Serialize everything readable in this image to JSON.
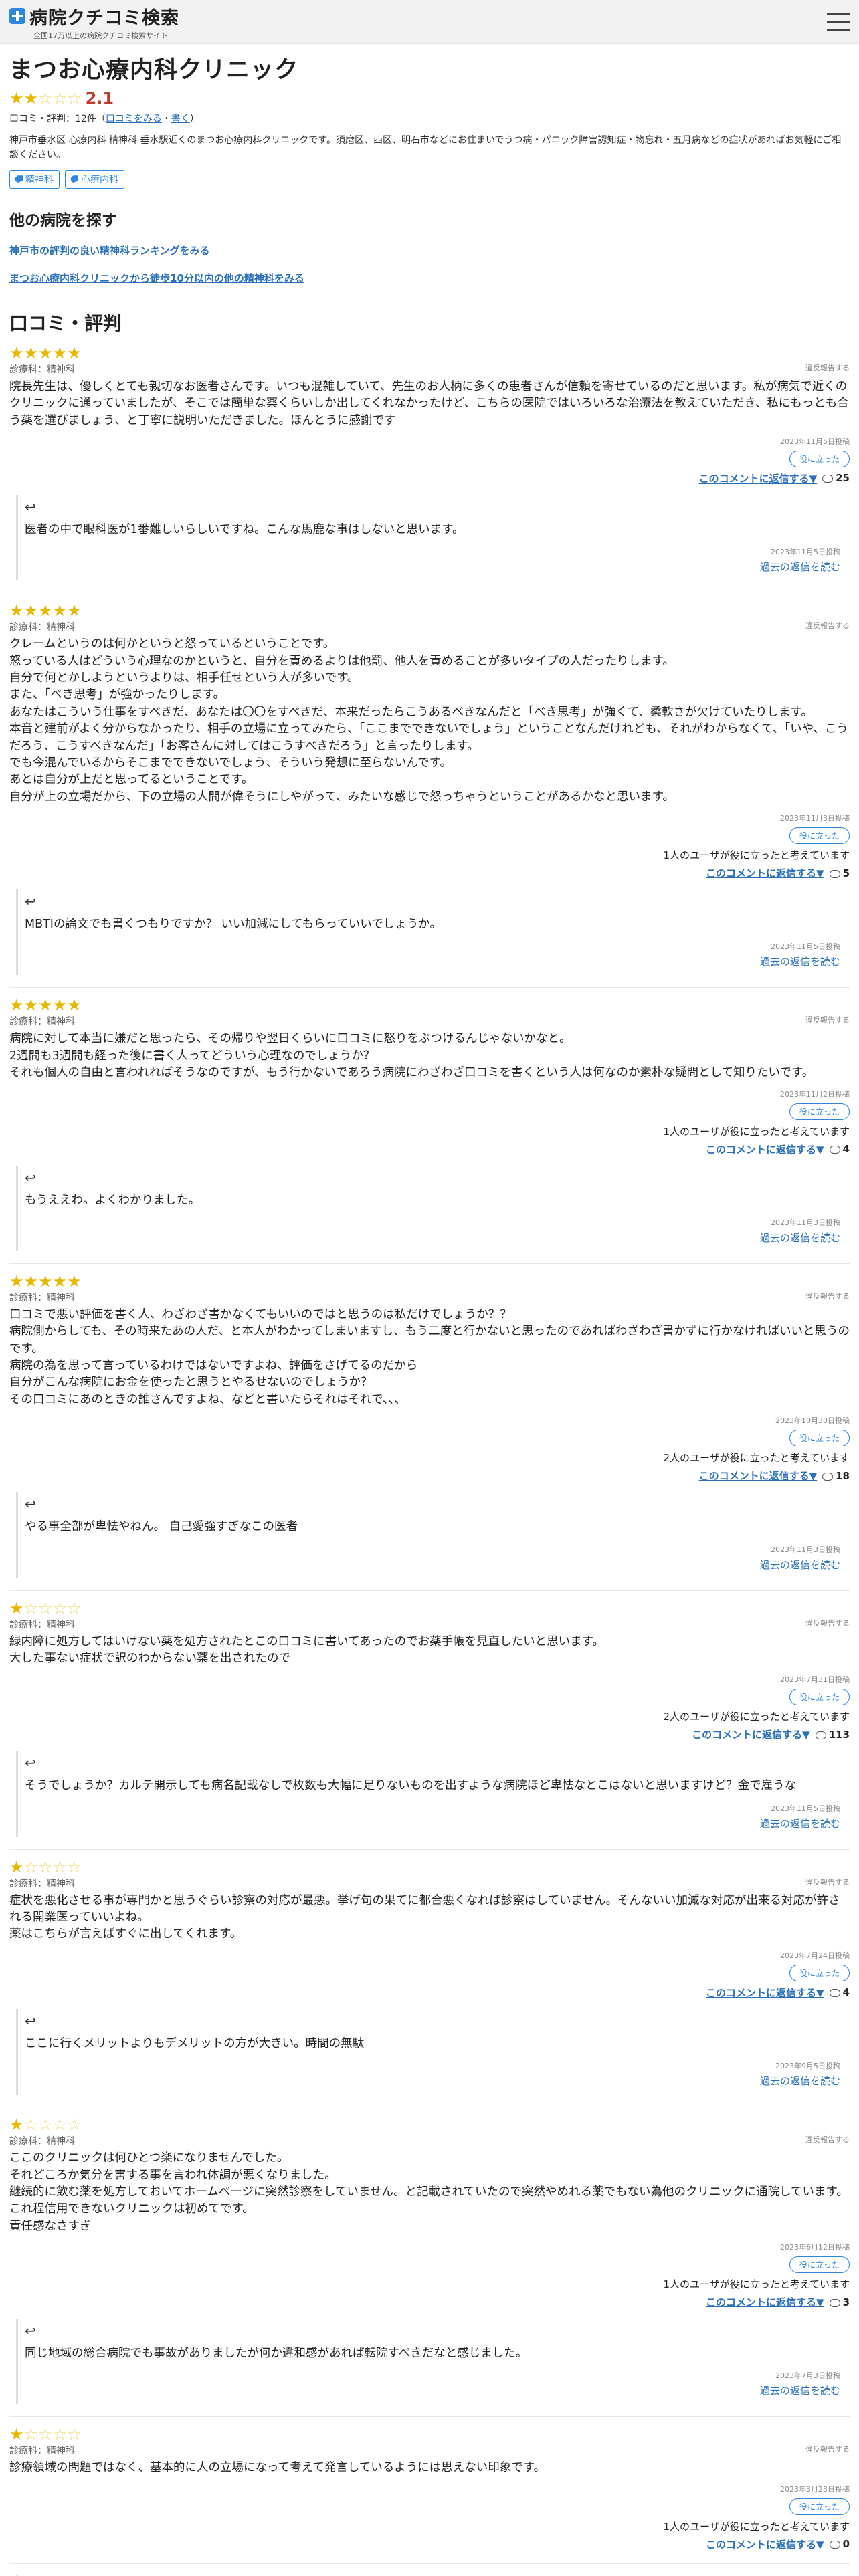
{
  "header": {
    "site_name": "病院クチコミ検索",
    "site_sub": "全国17万以上の病院クチコミ検索サイト"
  },
  "clinic": {
    "name": "まつお心療内科クリニック",
    "rating": "2.1",
    "rating_stars_filled": 2,
    "count_label": "口コミ・評判：12件（",
    "see_reviews": "口コミをみる",
    "sep": "・",
    "write": "書く",
    "count_close": "）",
    "description": "神戸市垂水区 心療内科 精神科 垂水駅近くのまつお心療内科クリニックです。須磨区、西区、明石市などにお住まいでうつ病・パニック障害認知症・物忘れ・五月病などの症状があればお気軽にご相談ください。",
    "tags": [
      "精神科",
      "心療内科"
    ]
  },
  "other": {
    "title": "他の病院を探す",
    "links": [
      "神戸市の評判の良い精神科ランキングをみる",
      "まつお心療内科クリニックから徒歩10分以内の他の精神科をみる"
    ]
  },
  "reviews_title": "口コミ・評判",
  "labels": {
    "report": "違反報告する",
    "helpful": "役に立った",
    "reply_to_comment": "このコメントに返信する▼",
    "past_replies": "過去の返信を読む"
  },
  "reviews": [
    {
      "stars": 5,
      "dept": "診療科：精神科",
      "text": "院長先生は、優しくとても親切なお医者さんです。いつも混雑していて、先生のお人柄に多くの患者さんが信頼を寄せているのだと思います。私が病気で近くのクリニックに通っていましたが、そこでは簡単な薬くらいしか出してくれなかったけど、こちらの医院ではいろいろな治療法を教えていただき、私にもっとも合う薬を選びましょう、と丁寧に説明いただきました。ほんとうに感謝です",
      "date": "2023年11月5日投稿",
      "helpful": "",
      "replies": "25",
      "reply": {
        "text": "医者の中で眼科医が1番難しいらしいですね。こんな馬鹿な事はしないと思います。",
        "date": "2023年11月5日投稿"
      }
    },
    {
      "stars": 5,
      "dept": "診療科：精神科",
      "text": "クレームというのは何かというと怒っているということです。\n怒っている人はどういう心理なのかというと、自分を責めるよりは他罰、他人を責めることが多いタイプの人だったりします。\n自分で何とかしようというよりは、相手任せという人が多いです。\nまた、「べき思考」が強かったりします。\nあなたはこういう仕事をすべきだ、あなたは〇〇をすべきだ、本来だったらこうあるべきなんだと「べき思考」が強くて、柔軟さが欠けていたりします。\n本音と建前がよく分からなかったり、相手の立場に立ってみたら、「ここまでできないでしょう」ということなんだけれども、それがわからなくて、「いや、こうだろう、こうすべきなんだ」「お客さんに対してはこうすべきだろう」と言ったりします。\nでも今混んでいるからそこまでできないでしょう、そういう発想に至らないんです。\nあとは自分が上だと思ってるということです。\n自分が上の立場だから、下の立場の人間が偉そうにしやがって、みたいな感じで怒っちゃうということがあるかなと思います。",
      "date": "2023年11月3日投稿",
      "helpful": "1人のユーザが役に立ったと考えています",
      "replies": "5",
      "reply": {
        "text": "MBTIの論文でも書くつもりですか？ いい加減にしてもらっていいでしょうか。",
        "date": "2023年11月5日投稿"
      }
    },
    {
      "stars": 5,
      "dept": "診療科：精神科",
      "text": "病院に対して本当に嫌だと思ったら、その帰りや翌日くらいに口コミに怒りをぶつけるんじゃないかなと。\n2週間も3週間も経った後に書く人ってどういう心理なのでしょうか？\nそれも個人の自由と言われればそうなのですが、もう行かないであろう病院にわざわざ口コミを書くという人は何なのか素朴な疑問として知りたいです。",
      "date": "2023年11月2日投稿",
      "helpful": "1人のユーザが役に立ったと考えています",
      "replies": "4",
      "reply": {
        "text": "もうええわ。よくわかりました。",
        "date": "2023年11月3日投稿"
      }
    },
    {
      "stars": 5,
      "dept": "診療科：精神科",
      "text": "口コミで悪い評価を書く人、わざわざ書かなくてもいいのではと思うのは私だけでしょうか？？\n病院側からしても、その時来たあの人だ、と本人がわかってしまいますし、もう二度と行かないと思ったのであればわざわざ書かずに行かなければいいと思うのです。\n病院の為を思って言っているわけではないですよね、評価をさげてるのだから\n自分がこんな病院にお金を使ったと思うとやるせないのでしょうか？\nその口コミにあのときの誰さんですよね、などと書いたらそれはそれで、、、",
      "date": "2023年10月30日投稿",
      "helpful": "2人のユーザが役に立ったと考えています",
      "replies": "18",
      "reply": {
        "text": "やる事全部が卑怯やねん。 自己愛強すぎなこの医者",
        "date": "2023年11月3日投稿"
      }
    },
    {
      "stars": 1,
      "dept": "診療科：精神科",
      "text": "緑内障に処方してはいけない薬を処方されたとこの口コミに書いてあったのでお薬手帳を見直したいと思います。\n大した事ない症状で訳のわからない薬を出されたので",
      "date": "2023年7月31日投稿",
      "helpful": "2人のユーザが役に立ったと考えています",
      "replies": "113",
      "reply": {
        "text": "そうでしょうか？カルテ開示しても病名記載なしで枚数も大幅に足りないものを出すような病院ほど卑怯なとこはないと思いますけど？金で雇うな",
        "date": "2023年11月5日投稿"
      }
    },
    {
      "stars": 1,
      "dept": "診療科：精神科",
      "text": "症状を悪化させる事が専門かと思うぐらい診察の対応が最悪。挙げ句の果てに都合悪くなれば診察はしていません。そんないい加減な対応が出来る対応が許される開業医っていいよね。\n薬はこちらが言えばすぐに出してくれます。",
      "date": "2023年7月24日投稿",
      "helpful": "",
      "replies": "4",
      "reply": {
        "text": "ここに行くメリットよりもデメリットの方が大きい。時間の無駄",
        "date": "2023年9月5日投稿"
      }
    },
    {
      "stars": 1,
      "dept": "診療科：精神科",
      "text": "ここのクリニックは何ひとつ楽になりませんでした。\nそれどころか気分を害する事を言われ体調が悪くなりました。\n継続的に飲む薬を処方しておいてホームページに突然診察をしていません。と記載されていたので突然やめれる薬でもない為他のクリニックに通院しています。\nこれ程信用できないクリニックは初めてです。\n責任感なさすぎ",
      "date": "2023年6月12日投稿",
      "helpful": "1人のユーザが役に立ったと考えています",
      "replies": "3",
      "reply": {
        "text": "同じ地域の総合病院でも事故がありましたが何か違和感があれば転院すべきだなと感じました。",
        "date": "2023年7月3日投稿"
      }
    },
    {
      "stars": 1,
      "dept": "診療科：精神科",
      "text": "診療領域の問題ではなく、基本的に人の立場になって考えて発言しているようには思えない印象です。",
      "date": "2023年3月23日投稿",
      "helpful": "1人のユーザが役に立ったと考えています",
      "replies": "0",
      "reply": null
    },
    {
      "stars": 1,
      "dept": "",
      "text": "",
      "date": "",
      "helpful": "",
      "replies": "",
      "reply": null
    }
  ]
}
